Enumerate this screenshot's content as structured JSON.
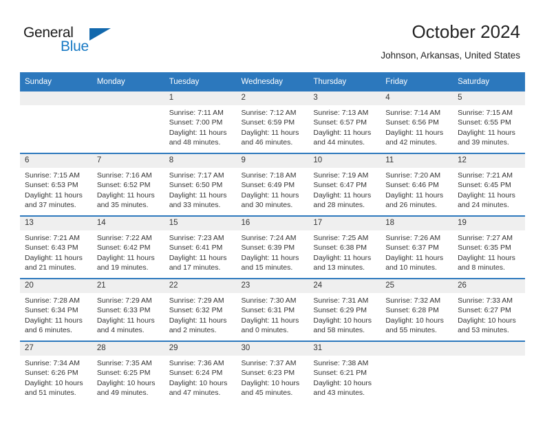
{
  "brand": {
    "name_part1": "General",
    "name_part2": "Blue",
    "logo_icon": "triangle-icon"
  },
  "header": {
    "title": "October 2024",
    "subtitle": "Johnson, Arkansas, United States"
  },
  "colors": {
    "header_blue": "#2c78bd",
    "daynum_band": "#efefef",
    "brand_blue": "#1779c4",
    "text": "#333333"
  },
  "weekday_headers": [
    "Sunday",
    "Monday",
    "Tuesday",
    "Wednesday",
    "Thursday",
    "Friday",
    "Saturday"
  ],
  "weeks": [
    [
      {
        "day": "",
        "lines": []
      },
      {
        "day": "",
        "lines": []
      },
      {
        "day": "1",
        "lines": [
          "Sunrise: 7:11 AM",
          "Sunset: 7:00 PM",
          "Daylight: 11 hours",
          "and 48 minutes."
        ]
      },
      {
        "day": "2",
        "lines": [
          "Sunrise: 7:12 AM",
          "Sunset: 6:59 PM",
          "Daylight: 11 hours",
          "and 46 minutes."
        ]
      },
      {
        "day": "3",
        "lines": [
          "Sunrise: 7:13 AM",
          "Sunset: 6:57 PM",
          "Daylight: 11 hours",
          "and 44 minutes."
        ]
      },
      {
        "day": "4",
        "lines": [
          "Sunrise: 7:14 AM",
          "Sunset: 6:56 PM",
          "Daylight: 11 hours",
          "and 42 minutes."
        ]
      },
      {
        "day": "5",
        "lines": [
          "Sunrise: 7:15 AM",
          "Sunset: 6:55 PM",
          "Daylight: 11 hours",
          "and 39 minutes."
        ]
      }
    ],
    [
      {
        "day": "6",
        "lines": [
          "Sunrise: 7:15 AM",
          "Sunset: 6:53 PM",
          "Daylight: 11 hours",
          "and 37 minutes."
        ]
      },
      {
        "day": "7",
        "lines": [
          "Sunrise: 7:16 AM",
          "Sunset: 6:52 PM",
          "Daylight: 11 hours",
          "and 35 minutes."
        ]
      },
      {
        "day": "8",
        "lines": [
          "Sunrise: 7:17 AM",
          "Sunset: 6:50 PM",
          "Daylight: 11 hours",
          "and 33 minutes."
        ]
      },
      {
        "day": "9",
        "lines": [
          "Sunrise: 7:18 AM",
          "Sunset: 6:49 PM",
          "Daylight: 11 hours",
          "and 30 minutes."
        ]
      },
      {
        "day": "10",
        "lines": [
          "Sunrise: 7:19 AM",
          "Sunset: 6:47 PM",
          "Daylight: 11 hours",
          "and 28 minutes."
        ]
      },
      {
        "day": "11",
        "lines": [
          "Sunrise: 7:20 AM",
          "Sunset: 6:46 PM",
          "Daylight: 11 hours",
          "and 26 minutes."
        ]
      },
      {
        "day": "12",
        "lines": [
          "Sunrise: 7:21 AM",
          "Sunset: 6:45 PM",
          "Daylight: 11 hours",
          "and 24 minutes."
        ]
      }
    ],
    [
      {
        "day": "13",
        "lines": [
          "Sunrise: 7:21 AM",
          "Sunset: 6:43 PM",
          "Daylight: 11 hours",
          "and 21 minutes."
        ]
      },
      {
        "day": "14",
        "lines": [
          "Sunrise: 7:22 AM",
          "Sunset: 6:42 PM",
          "Daylight: 11 hours",
          "and 19 minutes."
        ]
      },
      {
        "day": "15",
        "lines": [
          "Sunrise: 7:23 AM",
          "Sunset: 6:41 PM",
          "Daylight: 11 hours",
          "and 17 minutes."
        ]
      },
      {
        "day": "16",
        "lines": [
          "Sunrise: 7:24 AM",
          "Sunset: 6:39 PM",
          "Daylight: 11 hours",
          "and 15 minutes."
        ]
      },
      {
        "day": "17",
        "lines": [
          "Sunrise: 7:25 AM",
          "Sunset: 6:38 PM",
          "Daylight: 11 hours",
          "and 13 minutes."
        ]
      },
      {
        "day": "18",
        "lines": [
          "Sunrise: 7:26 AM",
          "Sunset: 6:37 PM",
          "Daylight: 11 hours",
          "and 10 minutes."
        ]
      },
      {
        "day": "19",
        "lines": [
          "Sunrise: 7:27 AM",
          "Sunset: 6:35 PM",
          "Daylight: 11 hours",
          "and 8 minutes."
        ]
      }
    ],
    [
      {
        "day": "20",
        "lines": [
          "Sunrise: 7:28 AM",
          "Sunset: 6:34 PM",
          "Daylight: 11 hours",
          "and 6 minutes."
        ]
      },
      {
        "day": "21",
        "lines": [
          "Sunrise: 7:29 AM",
          "Sunset: 6:33 PM",
          "Daylight: 11 hours",
          "and 4 minutes."
        ]
      },
      {
        "day": "22",
        "lines": [
          "Sunrise: 7:29 AM",
          "Sunset: 6:32 PM",
          "Daylight: 11 hours",
          "and 2 minutes."
        ]
      },
      {
        "day": "23",
        "lines": [
          "Sunrise: 7:30 AM",
          "Sunset: 6:31 PM",
          "Daylight: 11 hours",
          "and 0 minutes."
        ]
      },
      {
        "day": "24",
        "lines": [
          "Sunrise: 7:31 AM",
          "Sunset: 6:29 PM",
          "Daylight: 10 hours",
          "and 58 minutes."
        ]
      },
      {
        "day": "25",
        "lines": [
          "Sunrise: 7:32 AM",
          "Sunset: 6:28 PM",
          "Daylight: 10 hours",
          "and 55 minutes."
        ]
      },
      {
        "day": "26",
        "lines": [
          "Sunrise: 7:33 AM",
          "Sunset: 6:27 PM",
          "Daylight: 10 hours",
          "and 53 minutes."
        ]
      }
    ],
    [
      {
        "day": "27",
        "lines": [
          "Sunrise: 7:34 AM",
          "Sunset: 6:26 PM",
          "Daylight: 10 hours",
          "and 51 minutes."
        ]
      },
      {
        "day": "28",
        "lines": [
          "Sunrise: 7:35 AM",
          "Sunset: 6:25 PM",
          "Daylight: 10 hours",
          "and 49 minutes."
        ]
      },
      {
        "day": "29",
        "lines": [
          "Sunrise: 7:36 AM",
          "Sunset: 6:24 PM",
          "Daylight: 10 hours",
          "and 47 minutes."
        ]
      },
      {
        "day": "30",
        "lines": [
          "Sunrise: 7:37 AM",
          "Sunset: 6:23 PM",
          "Daylight: 10 hours",
          "and 45 minutes."
        ]
      },
      {
        "day": "31",
        "lines": [
          "Sunrise: 7:38 AM",
          "Sunset: 6:21 PM",
          "Daylight: 10 hours",
          "and 43 minutes."
        ]
      },
      {
        "day": "",
        "lines": []
      },
      {
        "day": "",
        "lines": []
      }
    ]
  ]
}
